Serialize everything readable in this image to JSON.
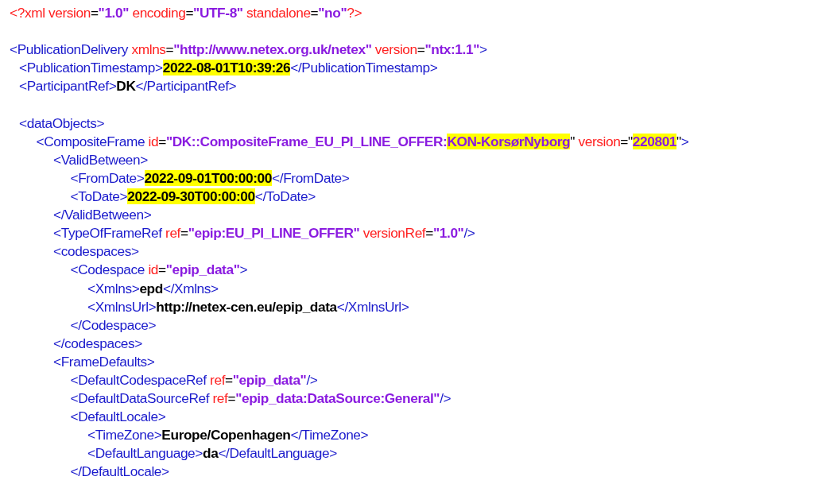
{
  "lines": [
    {
      "gap_before": false,
      "tokens": [
        {
          "kind": "pi",
          "text": "<?xml",
          "highlighted": false
        },
        {
          "kind": "attr",
          "text": " version",
          "highlighted": false
        },
        {
          "kind": "eq",
          "text": "=",
          "highlighted": false
        },
        {
          "kind": "value",
          "text": "\"1.0\"",
          "highlighted": false
        },
        {
          "kind": "attr",
          "text": " encoding",
          "highlighted": false
        },
        {
          "kind": "eq",
          "text": "=",
          "highlighted": false
        },
        {
          "kind": "value",
          "text": "\"UTF-8\"",
          "highlighted": false
        },
        {
          "kind": "attr",
          "text": " standalone",
          "highlighted": false
        },
        {
          "kind": "eq",
          "text": "=",
          "highlighted": false
        },
        {
          "kind": "value",
          "text": "\"no\"",
          "highlighted": false
        },
        {
          "kind": "pi",
          "text": "?>",
          "highlighted": false
        }
      ]
    },
    {
      "gap_before": true,
      "tokens": [
        {
          "kind": "tag",
          "text": "<PublicationDelivery",
          "highlighted": false
        },
        {
          "kind": "attr",
          "text": " xmlns",
          "highlighted": false
        },
        {
          "kind": "eq",
          "text": "=",
          "highlighted": false
        },
        {
          "kind": "value",
          "text": "\"http://www.netex.org.uk/netex\"",
          "highlighted": false
        },
        {
          "kind": "attr",
          "text": " version",
          "highlighted": false
        },
        {
          "kind": "eq",
          "text": "=",
          "highlighted": false
        },
        {
          "kind": "value",
          "text": "\"ntx:1.1\"",
          "highlighted": false
        },
        {
          "kind": "tag",
          "text": ">",
          "highlighted": false
        }
      ],
      "children": [
        {
          "gap_before": false,
          "tokens": [
            {
              "kind": "tag",
              "text": "<PublicationTimestamp>",
              "highlighted": false
            },
            {
              "kind": "text",
              "text": "2022-08-01T10:39:26",
              "highlighted": true
            },
            {
              "kind": "tag",
              "text": "</PublicationTimestamp>",
              "highlighted": false
            }
          ]
        },
        {
          "gap_before": false,
          "tokens": [
            {
              "kind": "tag",
              "text": "<ParticipantRef>",
              "highlighted": false
            },
            {
              "kind": "text",
              "text": "DK",
              "highlighted": false
            },
            {
              "kind": "tag",
              "text": "</ParticipantRef>",
              "highlighted": false
            }
          ]
        },
        {
          "gap_before": true,
          "tokens": [
            {
              "kind": "tag",
              "text": "<dataObjects>",
              "highlighted": false
            }
          ],
          "children": [
            {
              "gap_before": false,
              "tokens": [
                {
                  "kind": "tag",
                  "text": "<CompositeFrame",
                  "highlighted": false
                },
                {
                  "kind": "attr",
                  "text": " id",
                  "highlighted": false
                },
                {
                  "kind": "eq",
                  "text": "=",
                  "highlighted": false
                },
                {
                  "kind": "value",
                  "text": "\"DK::CompositeFrame_EU_PI_LINE_OFFER:",
                  "highlighted": false
                },
                {
                  "kind": "value",
                  "text": "KON-KorsørNyborg",
                  "highlighted": true
                },
                {
                  "kind": "eq",
                  "text": "\"",
                  "highlighted": false
                },
                {
                  "kind": "attr",
                  "text": " version",
                  "highlighted": false
                },
                {
                  "kind": "eq",
                  "text": "=\"",
                  "highlighted": false
                },
                {
                  "kind": "value",
                  "text": "220801",
                  "highlighted": true
                },
                {
                  "kind": "eq",
                  "text": "\"",
                  "highlighted": false
                },
                {
                  "kind": "tag",
                  "text": ">",
                  "highlighted": false
                }
              ],
              "children": [
                {
                  "gap_before": false,
                  "tokens": [
                    {
                      "kind": "tag",
                      "text": "<ValidBetween>",
                      "highlighted": false
                    }
                  ],
                  "children": [
                    {
                      "gap_before": false,
                      "tokens": [
                        {
                          "kind": "tag",
                          "text": "<FromDate>",
                          "highlighted": false
                        },
                        {
                          "kind": "text",
                          "text": "2022-09-01T00:00:00",
                          "highlighted": true
                        },
                        {
                          "kind": "tag",
                          "text": "</FromDate>",
                          "highlighted": false
                        }
                      ]
                    },
                    {
                      "gap_before": false,
                      "tokens": [
                        {
                          "kind": "tag",
                          "text": "<ToDate>",
                          "highlighted": false
                        },
                        {
                          "kind": "text",
                          "text": "2022-09-30T00:00:00",
                          "highlighted": true
                        },
                        {
                          "kind": "tag",
                          "text": "</ToDate>",
                          "highlighted": false
                        }
                      ]
                    }
                  ]
                },
                {
                  "gap_before": false,
                  "tokens": [
                    {
                      "kind": "tag",
                      "text": "</ValidBetween>",
                      "highlighted": false
                    }
                  ]
                },
                {
                  "gap_before": false,
                  "tokens": [
                    {
                      "kind": "tag",
                      "text": "<TypeOfFrameRef",
                      "highlighted": false
                    },
                    {
                      "kind": "attr",
                      "text": " ref",
                      "highlighted": false
                    },
                    {
                      "kind": "eq",
                      "text": "=",
                      "highlighted": false
                    },
                    {
                      "kind": "value",
                      "text": "\"epip:EU_PI_LINE_OFFER\"",
                      "highlighted": false
                    },
                    {
                      "kind": "attr",
                      "text": " versionRef",
                      "highlighted": false
                    },
                    {
                      "kind": "eq",
                      "text": "=",
                      "highlighted": false
                    },
                    {
                      "kind": "value",
                      "text": "\"1.0\"",
                      "highlighted": false
                    },
                    {
                      "kind": "tag",
                      "text": "/>",
                      "highlighted": false
                    }
                  ]
                },
                {
                  "gap_before": false,
                  "tokens": [
                    {
                      "kind": "tag",
                      "text": "<codespaces>",
                      "highlighted": false
                    }
                  ],
                  "children": [
                    {
                      "gap_before": false,
                      "tokens": [
                        {
                          "kind": "tag",
                          "text": "<Codespace",
                          "highlighted": false
                        },
                        {
                          "kind": "attr",
                          "text": " id",
                          "highlighted": false
                        },
                        {
                          "kind": "eq",
                          "text": "=",
                          "highlighted": false
                        },
                        {
                          "kind": "value",
                          "text": "\"epip_data\"",
                          "highlighted": false
                        },
                        {
                          "kind": "tag",
                          "text": ">",
                          "highlighted": false
                        }
                      ],
                      "children": [
                        {
                          "gap_before": false,
                          "tokens": [
                            {
                              "kind": "tag",
                              "text": "<Xmlns>",
                              "highlighted": false
                            },
                            {
                              "kind": "text",
                              "text": "epd",
                              "highlighted": false
                            },
                            {
                              "kind": "tag",
                              "text": "</Xmlns>",
                              "highlighted": false
                            }
                          ]
                        },
                        {
                          "gap_before": false,
                          "tokens": [
                            {
                              "kind": "tag",
                              "text": "<XmlnsUrl>",
                              "highlighted": false
                            },
                            {
                              "kind": "text",
                              "text": "http://netex-cen.eu/epip_data",
                              "highlighted": false
                            },
                            {
                              "kind": "tag",
                              "text": "</XmlnsUrl>",
                              "highlighted": false
                            }
                          ]
                        }
                      ]
                    },
                    {
                      "gap_before": false,
                      "tokens": [
                        {
                          "kind": "tag",
                          "text": "</Codespace>",
                          "highlighted": false
                        }
                      ]
                    }
                  ]
                },
                {
                  "gap_before": false,
                  "tokens": [
                    {
                      "kind": "tag",
                      "text": "</codespaces>",
                      "highlighted": false
                    }
                  ]
                },
                {
                  "gap_before": false,
                  "tokens": [
                    {
                      "kind": "tag",
                      "text": "<FrameDefaults>",
                      "highlighted": false
                    }
                  ],
                  "children": [
                    {
                      "gap_before": false,
                      "tokens": [
                        {
                          "kind": "tag",
                          "text": "<DefaultCodespaceRef",
                          "highlighted": false
                        },
                        {
                          "kind": "attr",
                          "text": " ref",
                          "highlighted": false
                        },
                        {
                          "kind": "eq",
                          "text": "=",
                          "highlighted": false
                        },
                        {
                          "kind": "value",
                          "text": "\"epip_data\"",
                          "highlighted": false
                        },
                        {
                          "kind": "tag",
                          "text": "/>",
                          "highlighted": false
                        }
                      ]
                    },
                    {
                      "gap_before": false,
                      "tokens": [
                        {
                          "kind": "tag",
                          "text": "<DefaultDataSourceRef",
                          "highlighted": false
                        },
                        {
                          "kind": "attr",
                          "text": " ref",
                          "highlighted": false
                        },
                        {
                          "kind": "eq",
                          "text": "=",
                          "highlighted": false
                        },
                        {
                          "kind": "value",
                          "text": "\"epip_data:DataSource:General\"",
                          "highlighted": false
                        },
                        {
                          "kind": "tag",
                          "text": "/>",
                          "highlighted": false
                        }
                      ]
                    },
                    {
                      "gap_before": false,
                      "tokens": [
                        {
                          "kind": "tag",
                          "text": "<DefaultLocale>",
                          "highlighted": false
                        }
                      ],
                      "children": [
                        {
                          "gap_before": false,
                          "tokens": [
                            {
                              "kind": "tag",
                              "text": "<TimeZone>",
                              "highlighted": false
                            },
                            {
                              "kind": "text",
                              "text": "Europe/Copenhagen",
                              "highlighted": false
                            },
                            {
                              "kind": "tag",
                              "text": "</TimeZone>",
                              "highlighted": false
                            }
                          ]
                        },
                        {
                          "gap_before": false,
                          "tokens": [
                            {
                              "kind": "tag",
                              "text": "<DefaultLanguage>",
                              "highlighted": false
                            },
                            {
                              "kind": "text",
                              "text": "da",
                              "highlighted": false
                            },
                            {
                              "kind": "tag",
                              "text": "</DefaultLanguage>",
                              "highlighted": false
                            }
                          ]
                        }
                      ]
                    },
                    {
                      "gap_before": false,
                      "tokens": [
                        {
                          "kind": "tag",
                          "text": "</DefaultLocale>",
                          "highlighted": false
                        }
                      ]
                    }
                  ]
                }
              ]
            }
          ]
        }
      ]
    }
  ]
}
